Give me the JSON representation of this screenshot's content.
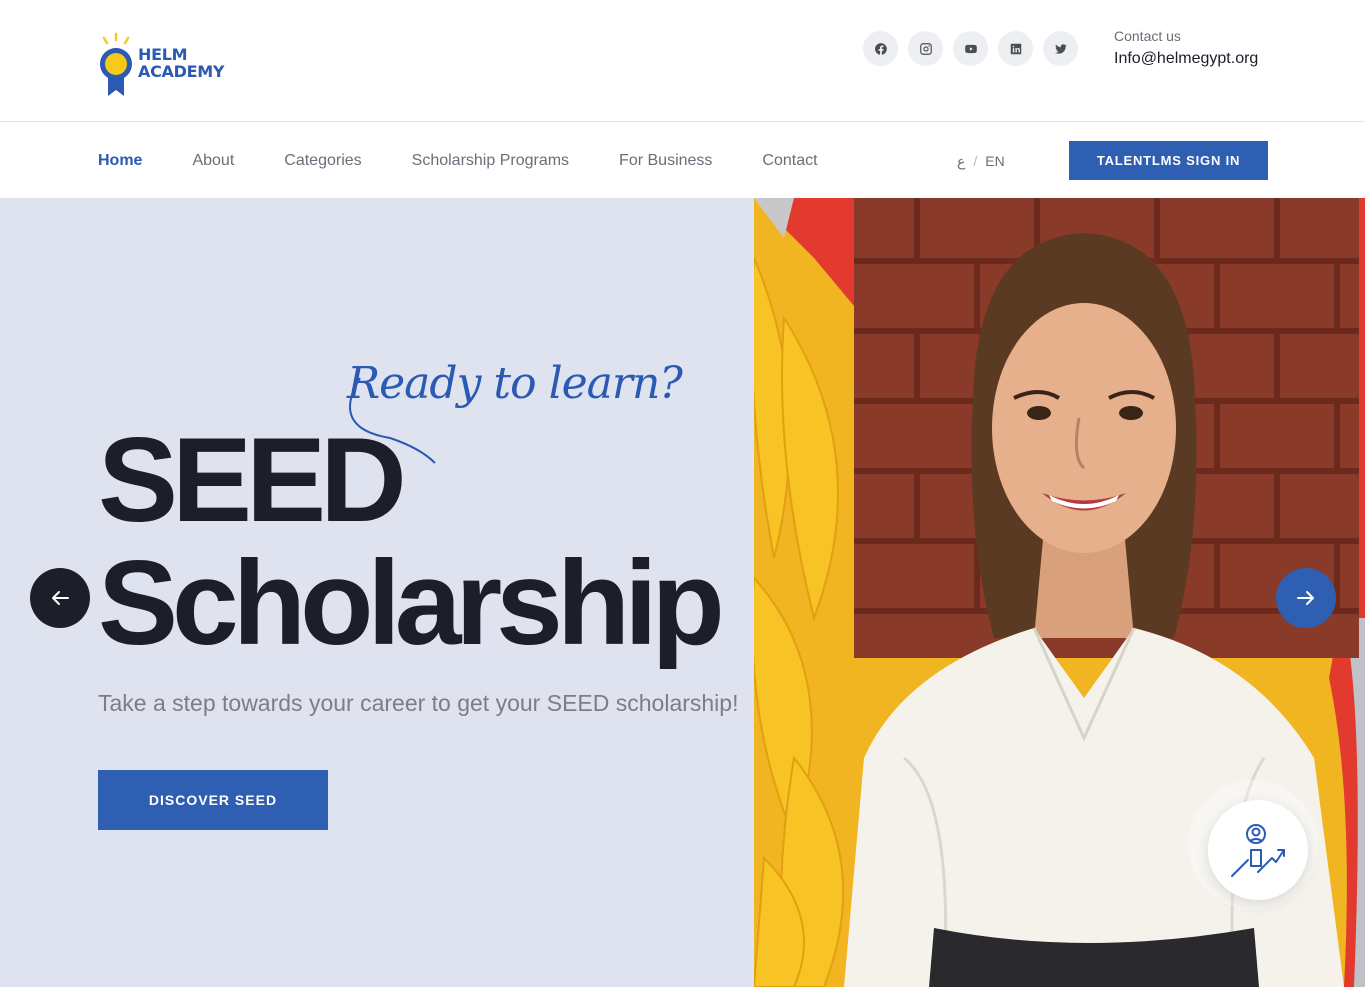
{
  "header": {
    "logo": {
      "line1": "HELM",
      "line2": "ACADEMY"
    },
    "socials": [
      {
        "icon": "facebook-icon"
      },
      {
        "icon": "instagram-icon"
      },
      {
        "icon": "youtube-icon"
      },
      {
        "icon": "linkedin-icon"
      },
      {
        "icon": "twitter-icon"
      }
    ],
    "contact": {
      "label": "Contact us",
      "email": "Info@helmegypt.org"
    }
  },
  "nav": {
    "items": [
      {
        "label": "Home",
        "active": true
      },
      {
        "label": "About"
      },
      {
        "label": "Categories"
      },
      {
        "label": "Scholarship Programs"
      },
      {
        "label": "For Business"
      },
      {
        "label": "Contact"
      }
    ],
    "lang": {
      "ar": "ع",
      "sep": "/",
      "en": "EN"
    },
    "signin_label": "TALENTLMS SIGN IN"
  },
  "hero": {
    "script_text": "Ready to learn?",
    "title_line1": "SEED",
    "title_line2": "Scholarship",
    "subtitle": "Take a step towards your career to get your SEED scholarship!",
    "cta_label": "DISCOVER SEED"
  },
  "colors": {
    "brand_blue": "#2f5fb3",
    "hero_bg": "#dfe3ef",
    "dark": "#1c1f2a",
    "logo_yellow": "#f7c91a"
  }
}
